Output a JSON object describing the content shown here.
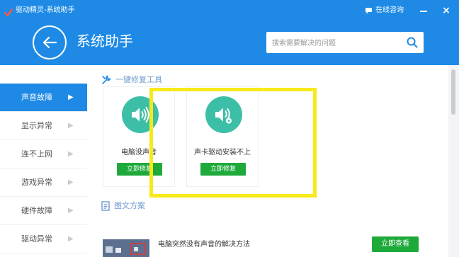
{
  "window": {
    "title": "驱动精灵-系统助手",
    "support_label": "在线咨询",
    "icons": {
      "logo": "checkmark-logo",
      "support": "chat-bubble-icon",
      "minimize": "minimize-icon",
      "close": "close-icon"
    }
  },
  "header": {
    "title": "系统助手",
    "search_placeholder": "搜索需要解决的问题",
    "icons": {
      "back": "back-arrow-icon",
      "search": "search-icon"
    }
  },
  "sidebar": {
    "items": [
      {
        "label": "声音故障",
        "active": true
      },
      {
        "label": "显示异常",
        "active": false
      },
      {
        "label": "连不上网",
        "active": false
      },
      {
        "label": "游戏异常",
        "active": false
      },
      {
        "label": "硬件故障",
        "active": false
      },
      {
        "label": "驱动异常",
        "active": false
      }
    ]
  },
  "tools_section": {
    "title": "一键修复工具",
    "icon": "wrench-icon",
    "cards": [
      {
        "name": "电脑没声音",
        "button": "立即修复",
        "icon": "speaker-icon"
      },
      {
        "name": "声卡驱动安装不上",
        "button": "立即修复",
        "icon": "speaker-settings-icon"
      }
    ]
  },
  "articles_section": {
    "title": "图文方案",
    "icon": "document-icon",
    "items": [
      {
        "title": "电脑突然没有声音的解决方法",
        "button": "立即查看"
      }
    ]
  },
  "colors": {
    "primary": "#1e8ae6",
    "active_nav": "#1e8ae6",
    "tool_circle": "#3cbfa6",
    "action_button": "#1eaa3b",
    "highlight": "#f6ea1c",
    "section_title": "#6f9bcf"
  }
}
